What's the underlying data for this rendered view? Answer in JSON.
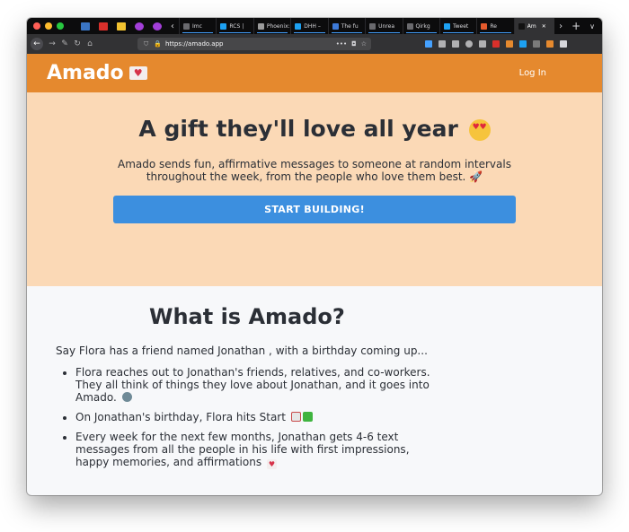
{
  "browser": {
    "tabs": [
      {
        "title": "Imc",
        "icon_color": "#6a6a6e"
      },
      {
        "title": "RCS |",
        "icon_color": "#1da1f2"
      },
      {
        "title": "Phoenix: C",
        "icon_color": "#9b9b9b"
      },
      {
        "title": "DHH –",
        "icon_color": "#1da1f2"
      },
      {
        "title": "The fu",
        "icon_color": "#3d7ad8"
      },
      {
        "title": "Unrea",
        "icon_color": "#6a6a6e"
      },
      {
        "title": "Qirkg",
        "icon_color": "#6a6a6e"
      },
      {
        "title": "Tweet",
        "icon_color": "#1da1f2"
      },
      {
        "title": "Re",
        "icon_color": "#e45a2c"
      },
      {
        "title": "Am",
        "icon_color": "#111111",
        "active": true
      }
    ],
    "url": "https://amado.app"
  },
  "site": {
    "brand": "Amado",
    "login": "Log In",
    "hero_title": "A gift they'll love all year",
    "hero_text": "Amado sends fun, affirmative messages to someone at random intervals throughout the week, from the people who love them best.",
    "cta": "START BUILDING!",
    "section_title": "What is Amado?",
    "intro_text": "Say Flora has a friend named Jonathan , with a birthday coming up...",
    "bullets": [
      "Flora reaches out to Jonathan's friends, relatives, and co-workers. They all think of things they love about Jonathan, and it goes into Amado.",
      "On Jonathan's birthday, Flora hits Start",
      "Every week for the next few months, Jonathan gets 4-6 text messages from all the people in his life with first impressions, happy memories, and affirmations"
    ]
  },
  "colors": {
    "header": "#e5892e",
    "hero_bg": "#fbd9b6",
    "cta": "#3c8fdf",
    "body_bg": "#f7f8fa"
  }
}
